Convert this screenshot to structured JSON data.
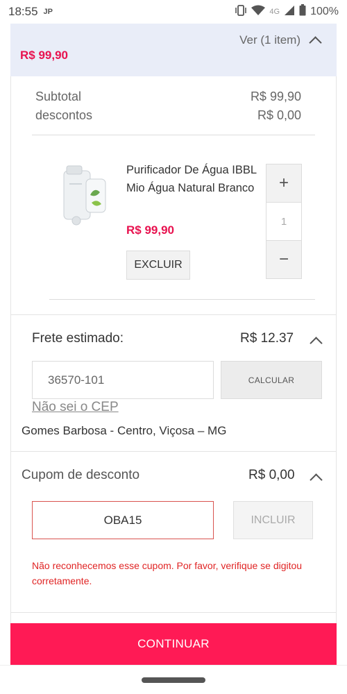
{
  "status_bar": {
    "time": "18:55",
    "app_badge": "JP",
    "network": "4G",
    "battery": "100%"
  },
  "summary": {
    "total": "R$ 99,90",
    "toggle_label": "Ver (1 item)"
  },
  "totals": {
    "subtotal_label": "Subtotal",
    "subtotal_value": "R$ 99,90",
    "discount_label": "descontos",
    "discount_value": "R$ 0,00"
  },
  "product": {
    "name": "Purificador De Água IBBL Mio Água Natural Branco",
    "price": "R$ 99,90",
    "remove_label": "EXCLUIR",
    "quantity": "1",
    "increment_label": "+",
    "decrement_label": "−"
  },
  "shipping": {
    "label": "Frete estimado:",
    "value": "R$ 12.37",
    "cep_value": "36570-101",
    "calculate_label": "CALCULAR",
    "unknown_cep_link": "Não sei o CEP",
    "address": "Gomes Barbosa - Centro, Viçosa – MG"
  },
  "coupon": {
    "label": "Cupom de desconto",
    "value": "R$ 0,00",
    "code": "OBA15",
    "apply_label": "INCLUIR",
    "error": "Não reconhecemos esse cupom. Por favor, verifique se digitou corretamente."
  },
  "footer": {
    "continue_label": "CONTINUAR"
  },
  "colors": {
    "accent": "#ff1a55",
    "price": "#e8124f",
    "error": "#e02424",
    "header_bg": "#e9edf8"
  }
}
